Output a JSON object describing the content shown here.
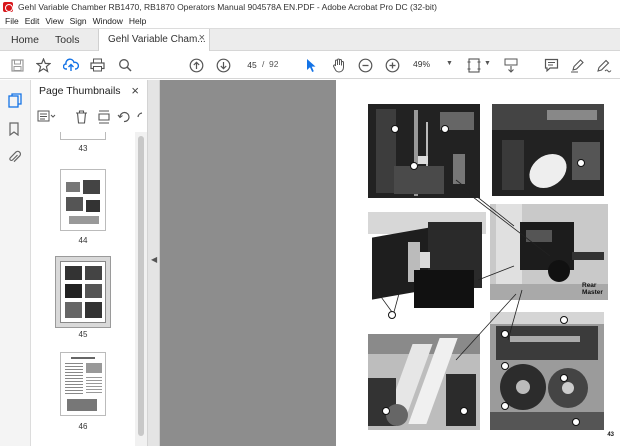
{
  "window": {
    "title": "Gehl Variable Chamber RB1470, RB1870 Operators Manual 904578A EN.PDF - Adobe Acrobat Pro DC (32-bit)"
  },
  "menu": [
    "File",
    "Edit",
    "View",
    "Sign",
    "Window",
    "Help"
  ],
  "tabs": {
    "home": "Home",
    "tools": "Tools",
    "document": "Gehl Variable Cham...",
    "close": "×"
  },
  "toolbar": {
    "current_page": "45",
    "separator": "/",
    "total_pages": "92",
    "zoom": "49%",
    "icons": [
      "save-icon",
      "bookmark-star-icon",
      "upload-cloud-icon",
      "print-icon",
      "search-icon",
      "page-up-icon",
      "page-down-icon",
      "select-cursor-icon",
      "hand-icon",
      "zoom-out-icon",
      "zoom-in-icon",
      "page-fit-icon",
      "scroll-mode-icon",
      "comment-icon",
      "highlight-pen-icon",
      "sign-pen-icon"
    ]
  },
  "sidebar": {
    "title": "Page Thumbnails",
    "close": "×",
    "thumbnails": [
      {
        "page": "43"
      },
      {
        "page": "44"
      },
      {
        "page": "45",
        "selected": true
      },
      {
        "page": "46"
      }
    ]
  },
  "document": {
    "page_number": "43",
    "rear_label_line1": "Rear",
    "rear_label_line2": "Master",
    "callouts": [
      "13",
      "10",
      "11",
      "9",
      "12",
      "10",
      "18",
      "11",
      "8",
      "1",
      "2",
      "3",
      "4",
      "5",
      "6",
      "7",
      "8",
      "10"
    ]
  },
  "colors": {
    "accent": "#1473e6",
    "viewport_bg": "#8d8d8d",
    "brand_red": "#d8161b"
  }
}
